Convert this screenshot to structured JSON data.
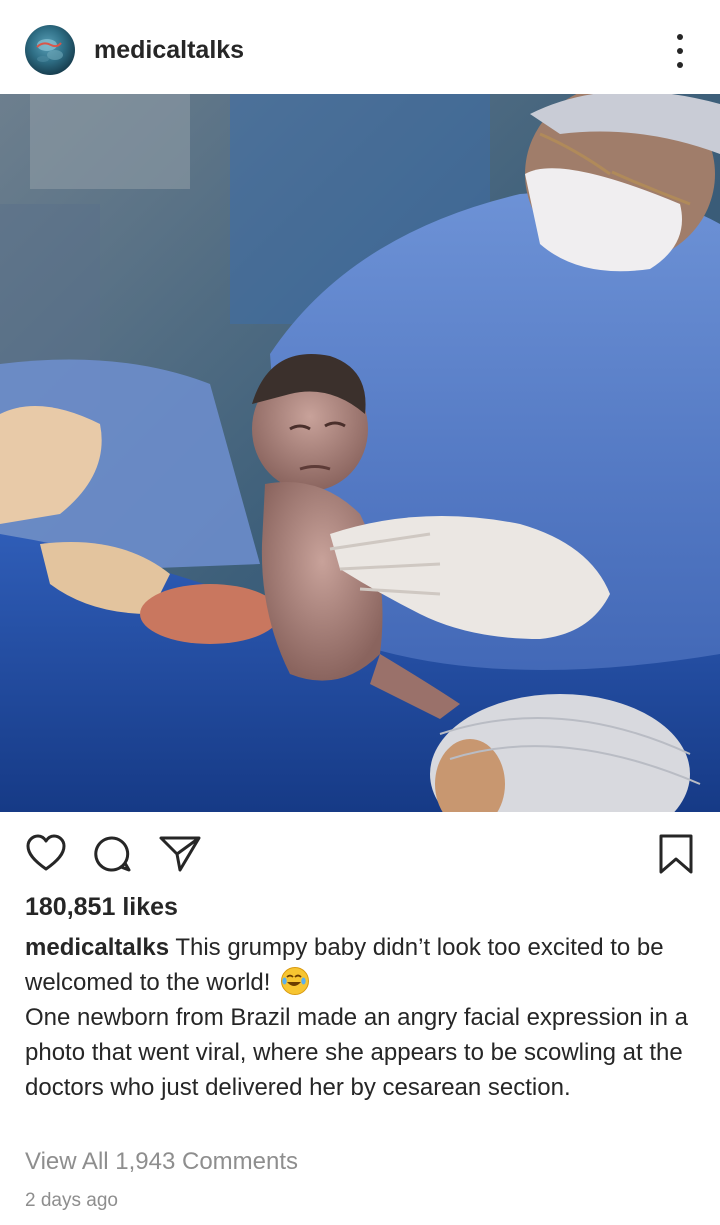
{
  "post": {
    "username": "medicaltalks",
    "more_icon": "more-vertical-icon",
    "photo_icon": "post-photo"
  },
  "actions": {
    "like_icon": "heart-icon",
    "comment_icon": "comment-icon",
    "share_icon": "send-icon",
    "save_icon": "bookmark-icon"
  },
  "likes_text": "180,851 likes",
  "caption": {
    "username": "medicaltalks",
    "text_1": "This grumpy baby didn’t look too excited to be welcomed to the world!",
    "emoji": "tears-of-joy-emoji",
    "text_2": "One newborn from Brazil made an angry facial expression in a photo that went viral, where she appears to be scowling at the doctors who just delivered her by cesarean section."
  },
  "comments_link": "View All 1,943 Comments",
  "timestamp": "2 days ago",
  "colors": {
    "text": "#262626",
    "muted": "#8e8e8e",
    "background": "#ffffff"
  }
}
